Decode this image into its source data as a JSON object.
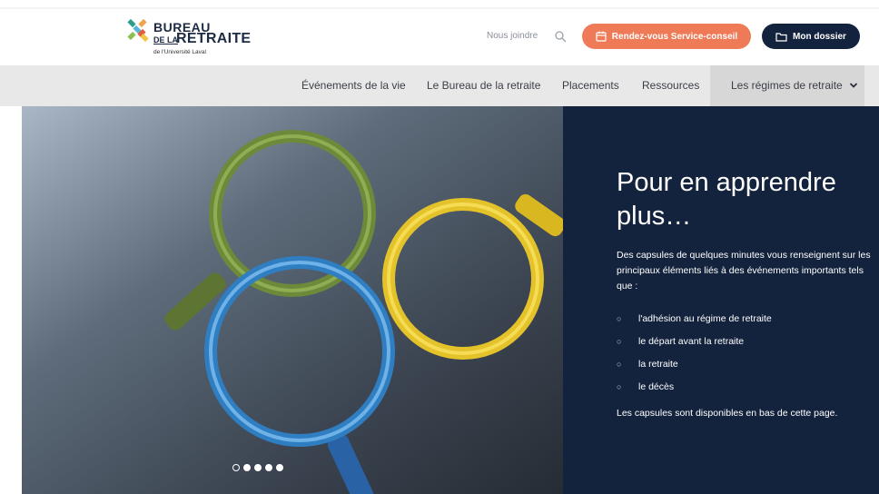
{
  "header": {
    "logo": {
      "line1": "BUREAU",
      "line2a": "DE LA",
      "line2b": "RETRAITE",
      "line3": "de l'Université Laval"
    },
    "contact_label": "Nous joindre",
    "appointment_button": "Rendez-vous Service-conseil",
    "dossier_button": "Mon dossier"
  },
  "nav": {
    "items": [
      {
        "label": "Événements de la vie"
      },
      {
        "label": "Le Bureau de la retraite"
      },
      {
        "label": "Placements"
      },
      {
        "label": "Ressources"
      },
      {
        "label": "Les régimes de retraite"
      }
    ]
  },
  "hero": {
    "title": "Pour en apprendre plus…",
    "intro": "Des capsules de quelques minutes vous renseignent sur les principaux éléments liés à des événements importants tels que :",
    "list": [
      "l'adhésion au régime de retraite",
      "le départ avant la retraite",
      "la retraite",
      "le décès"
    ],
    "outro": "Les capsules sont disponibles en bas de cette page.",
    "carousel_active": 1,
    "carousel_count": 5
  },
  "colors": {
    "brand_navy": "#14233d",
    "accent_orange": "#ef7a57",
    "nav_bg": "#e8e8e8"
  },
  "icons": [
    "search-icon",
    "calendar-icon",
    "folder-icon",
    "chevron-down-icon"
  ]
}
